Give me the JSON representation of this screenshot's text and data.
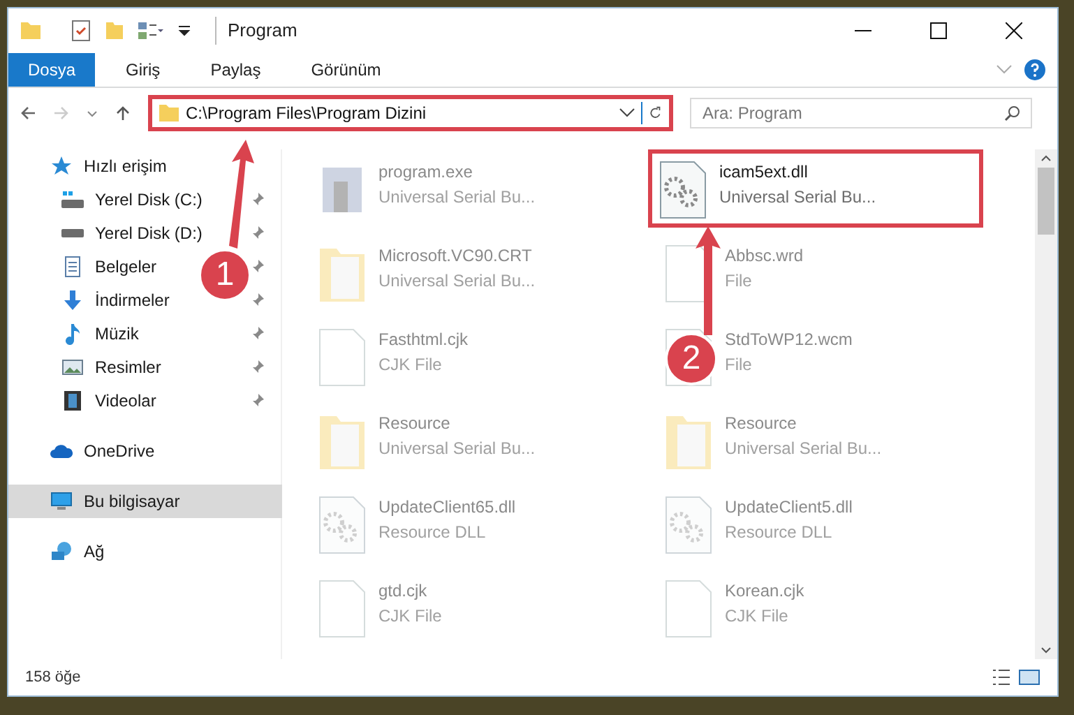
{
  "window": {
    "title": "Program"
  },
  "ribbon_tabs": [
    {
      "label": "Dosya",
      "selected": true
    },
    {
      "label": "Giriş",
      "selected": false
    },
    {
      "label": "Paylaş",
      "selected": false
    },
    {
      "label": "Görünüm",
      "selected": false
    }
  ],
  "address_bar": {
    "path": "C:\\Program Files\\Program Dizini",
    "highlighted": true
  },
  "search": {
    "placeholder": "Ara: Program"
  },
  "sidebar": {
    "items": [
      {
        "label": "Hızlı erişim",
        "kind": "star",
        "pinned": false,
        "selected": false,
        "children": [
          {
            "label": "Yerel Disk (C:)",
            "kind": "drive-win",
            "pinned": true,
            "selected": false
          },
          {
            "label": "Yerel Disk (D:)",
            "kind": "drive",
            "pinned": true,
            "selected": false
          },
          {
            "label": "Belgeler",
            "kind": "docs",
            "pinned": true,
            "selected": false
          },
          {
            "label": "İndirmeler",
            "kind": "download",
            "pinned": true,
            "selected": false
          },
          {
            "label": "Müzik",
            "kind": "music",
            "pinned": true,
            "selected": false
          },
          {
            "label": "Resimler",
            "kind": "pictures",
            "pinned": true,
            "selected": false
          },
          {
            "label": "Videolar",
            "kind": "video",
            "pinned": true,
            "selected": false
          }
        ]
      },
      {
        "label": "OneDrive",
        "kind": "cloud",
        "pinned": false,
        "selected": false
      },
      {
        "label": "Bu bilgisayar",
        "kind": "pc",
        "pinned": false,
        "selected": true
      },
      {
        "label": "Ağ",
        "kind": "network",
        "pinned": false,
        "selected": false
      }
    ]
  },
  "files": [
    {
      "name": "program.exe",
      "type": "Universal Serial Bu...",
      "kind": "exe",
      "faded": true,
      "highlighted": false
    },
    {
      "name": "icam5ext.dll",
      "type": "Universal Serial Bu...",
      "kind": "dll",
      "faded": false,
      "highlighted": true
    },
    {
      "name": "Microsoft.VC90.CRT",
      "type": "Universal Serial Bu...",
      "kind": "folder",
      "faded": true,
      "highlighted": false
    },
    {
      "name": "Abbsc.wrd",
      "type": "File",
      "kind": "file",
      "faded": true,
      "highlighted": false
    },
    {
      "name": "Fasthtml.cjk",
      "type": "CJK File",
      "kind": "file",
      "faded": true,
      "highlighted": false
    },
    {
      "name": "StdToWP12.wcm",
      "type": "File",
      "kind": "file",
      "faded": true,
      "highlighted": false
    },
    {
      "name": "Resource",
      "type": "Universal Serial Bu...",
      "kind": "folder",
      "faded": true,
      "highlighted": false
    },
    {
      "name": "Resource",
      "type": "Universal Serial Bu...",
      "kind": "folder",
      "faded": true,
      "highlighted": false
    },
    {
      "name": "UpdateClient65.dll",
      "type": "Resource DLL",
      "kind": "dll",
      "faded": true,
      "highlighted": false
    },
    {
      "name": "UpdateClient5.dll",
      "type": "Resource DLL",
      "kind": "dll",
      "faded": true,
      "highlighted": false
    },
    {
      "name": "gtd.cjk",
      "type": "CJK File",
      "kind": "file",
      "faded": true,
      "highlighted": false
    },
    {
      "name": "Korean.cjk",
      "type": "CJK File",
      "kind": "file",
      "faded": true,
      "highlighted": false
    }
  ],
  "status_bar": {
    "count": "158 öğe"
  },
  "annotations": [
    {
      "number": "1"
    },
    {
      "number": "2"
    }
  ]
}
